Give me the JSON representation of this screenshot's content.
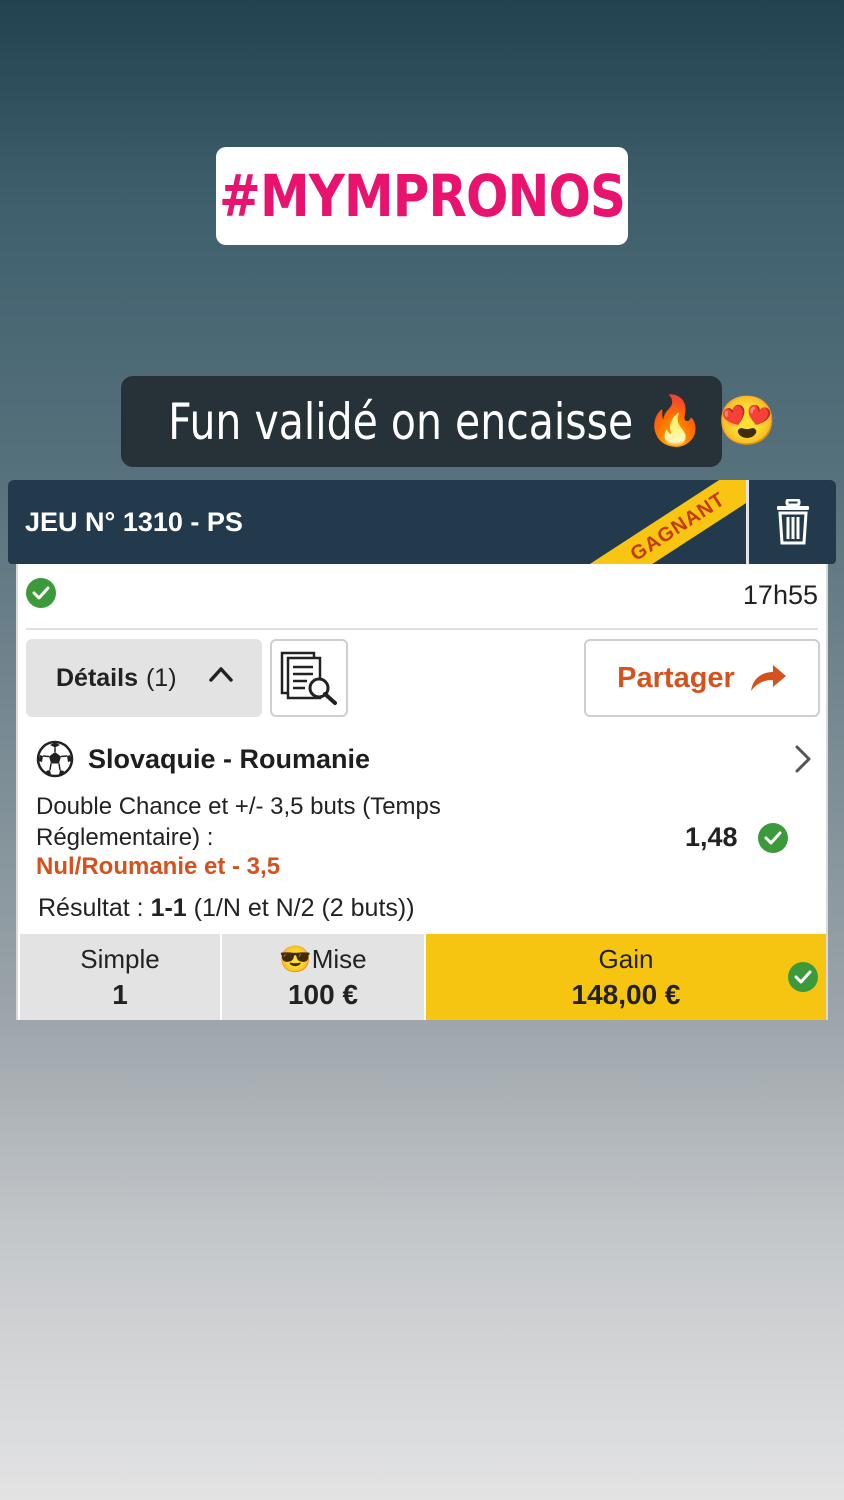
{
  "story": {
    "hashtag": "#MYMPRONOS",
    "caption": "Fun validé on encaisse",
    "caption_emojis": [
      "🔥",
      "😍"
    ]
  },
  "bet": {
    "title": "JEU N° 1310 - PS",
    "status_ribbon": "GAGNANT",
    "time": "17h55",
    "details_label": "Détails",
    "details_count": "(1)",
    "share_label": "Partager",
    "match": {
      "name": "Slovaquie - Roumanie",
      "market": "Double Chance et +/- 3,5 buts (Temps Réglementaire) :",
      "selection": "Nul/Roumanie et - 3,5",
      "odds": "1,48",
      "result_label": "Résultat :",
      "result_score": "1-1",
      "result_detail": "(1/N et N/2 (2 buts))"
    },
    "footer": {
      "type_label": "Simple",
      "type_value": "1",
      "stake_emoji": "😎",
      "stake_label": "Mise",
      "stake_value": "100 €",
      "gain_label": "Gain",
      "gain_value": "148,00 €"
    }
  },
  "colors": {
    "hashtag_pink": "#e8126f",
    "header_navy": "#223a4b",
    "ribbon_yellow": "#f8c512",
    "accent_orange": "#d4521d",
    "success_green": "#3c9a3a",
    "gain_yellow": "#f6c511"
  },
  "icons": [
    "trash-icon",
    "check-circle-icon",
    "chevron-up-icon",
    "document-search-icon",
    "share-arrow-icon",
    "soccer-ball-icon",
    "chevron-right-icon"
  ]
}
